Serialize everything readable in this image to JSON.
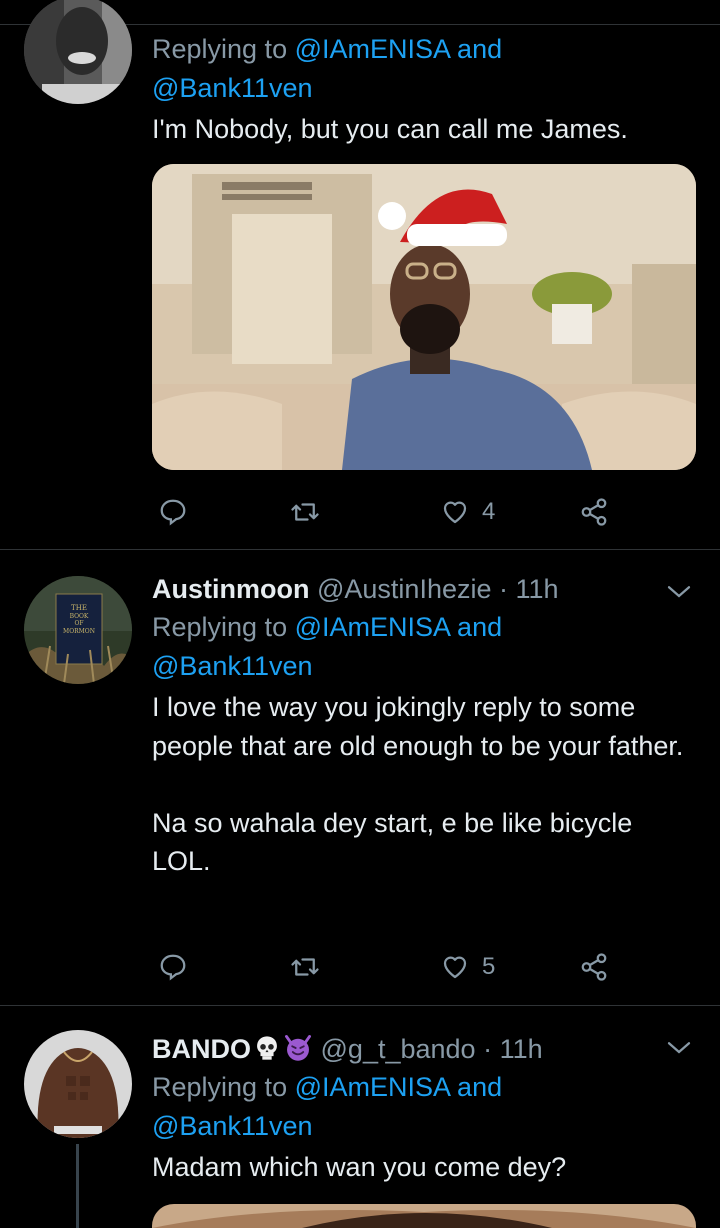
{
  "tweets": [
    {
      "name": "",
      "handle": "",
      "time": "",
      "replying_prefix": "Replying to ",
      "replying_to_1": "@IAmENISA",
      "replying_and": " and",
      "replying_to_2": "@Bank11ven",
      "text": "I'm Nobody, but you can call me James.",
      "has_media": true,
      "likes": "4"
    },
    {
      "name": "Austinmoon",
      "handle": "@AustinIhezie",
      "separator": " · ",
      "time": "11h",
      "replying_prefix": "Replying to ",
      "replying_to_1": "@IAmENISA",
      "replying_and": " and",
      "replying_to_2": "@Bank11ven",
      "text": "I love the way you jokingly reply to some people that are old enough to be your father.\n\nNa so wahala dey start, e be like bicycle LOL.",
      "likes": "5",
      "avatar_text": [
        "THE",
        "BOOK",
        "OF",
        "MORMON"
      ]
    },
    {
      "name": "BANDO",
      "name_emojis": [
        "skull-emoji",
        "smiling-imp-emoji"
      ],
      "handle": "@g_t_bando",
      "separator": " · ",
      "time": "11h",
      "replying_prefix": "Replying to ",
      "replying_to_1": "@IAmENISA",
      "replying_and": " and",
      "replying_to_2": "@Bank11ven",
      "text": "Madam which wan you come dey?"
    }
  ],
  "icons": {
    "reply": "reply-icon",
    "retweet": "retweet-icon",
    "like": "heart-icon",
    "share": "share-icon",
    "menu": "chevron-down-icon"
  },
  "colors": {
    "background": "#000000",
    "text": "#e6ecf0",
    "secondary": "#8899a6",
    "link": "#1da1f2",
    "divider": "#2f3336"
  }
}
